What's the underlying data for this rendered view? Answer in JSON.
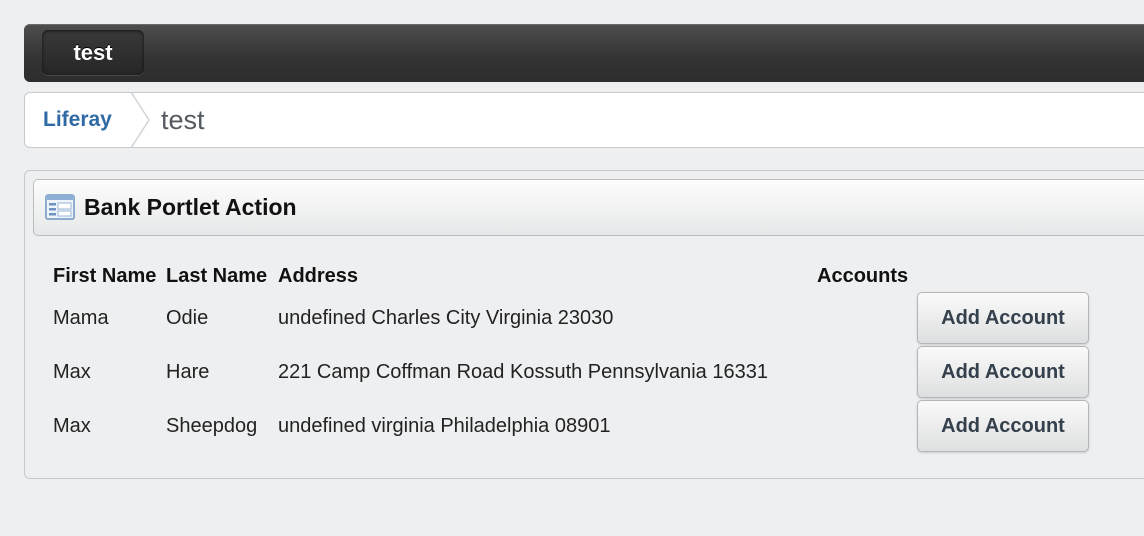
{
  "nav": {
    "site_tab": "test"
  },
  "breadcrumb": {
    "home": "Liferay",
    "current": "test"
  },
  "portlet": {
    "title": "Bank Portlet Action",
    "icon": "portlet-window-icon"
  },
  "table": {
    "headers": {
      "first_name": "First Name",
      "last_name": "Last Name",
      "address": "Address",
      "accounts": "Accounts"
    },
    "rows": [
      {
        "first_name": "Mama",
        "last_name": "Odie",
        "address": "undefined Charles City Virginia 23030",
        "action": "Add Account"
      },
      {
        "first_name": "Max",
        "last_name": "Hare",
        "address": "221 Camp Coffman Road Kossuth Pennsylvania 16331",
        "action": "Add Account"
      },
      {
        "first_name": "Max",
        "last_name": "Sheepdog",
        "address": "undefined virginia Philadelphia 08901",
        "action": "Add Account"
      }
    ]
  }
}
